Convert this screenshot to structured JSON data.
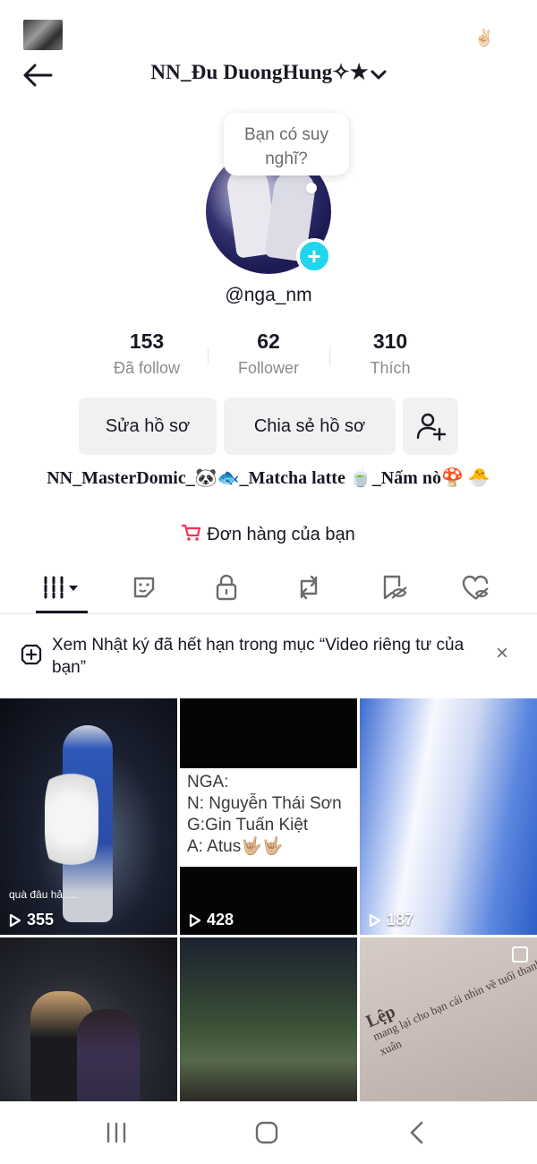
{
  "status_bar": {
    "right_emoji": "✌🏻"
  },
  "header": {
    "username": "NN_Đu DuongHung✧★",
    "chevron": "❯"
  },
  "profile": {
    "thought_bubble": "Bạn có suy nghĩ?",
    "handle": "@nga_nm",
    "add_badge": "+"
  },
  "stats": [
    {
      "value": "153",
      "label": "Đã follow"
    },
    {
      "value": "62",
      "label": "Follower"
    },
    {
      "value": "310",
      "label": "Thích"
    }
  ],
  "actions": {
    "edit_profile": "Sửa hồ sơ",
    "share_profile": "Chia sẻ hồ sơ"
  },
  "bio": "NN_MasterDomic_🐼🐟_Matcha latte 🍵_Nấm nò🍄 🐣",
  "orders": {
    "label": "Đơn hàng của bạn"
  },
  "tabs": [
    {
      "icon": "videos-grid-icon",
      "active": true
    },
    {
      "icon": "sticker-icon",
      "active": false
    },
    {
      "icon": "lock-icon",
      "active": false
    },
    {
      "icon": "repost-icon",
      "active": false
    },
    {
      "icon": "favorites-icon",
      "active": false
    },
    {
      "icon": "liked-icon",
      "active": false
    }
  ],
  "notice": {
    "text": "Xem Nhật ký đã hết hạn trong mục “Video riêng tư của bạn”",
    "close": "×"
  },
  "videos": [
    {
      "views": "355",
      "caption": "quà đâu hả....."
    },
    {
      "views": "428",
      "lines": [
        "NGA:",
        "N: Nguyễn Thái Sơn",
        "G:Gin Tuấn Kiệt",
        "A: Atus🤟🏼🤟🏼"
      ]
    },
    {
      "views": "187"
    },
    {
      "views": ""
    },
    {
      "views": ""
    },
    {
      "views": "",
      "title": "Lệp",
      "text": "mang lại cho bạn cái nhìn về tuổi thanh xuân"
    }
  ],
  "colors": {
    "accent": "#fe2c55",
    "badge": "#20d5ec",
    "text": "#161823",
    "muted": "#8a8b91"
  }
}
